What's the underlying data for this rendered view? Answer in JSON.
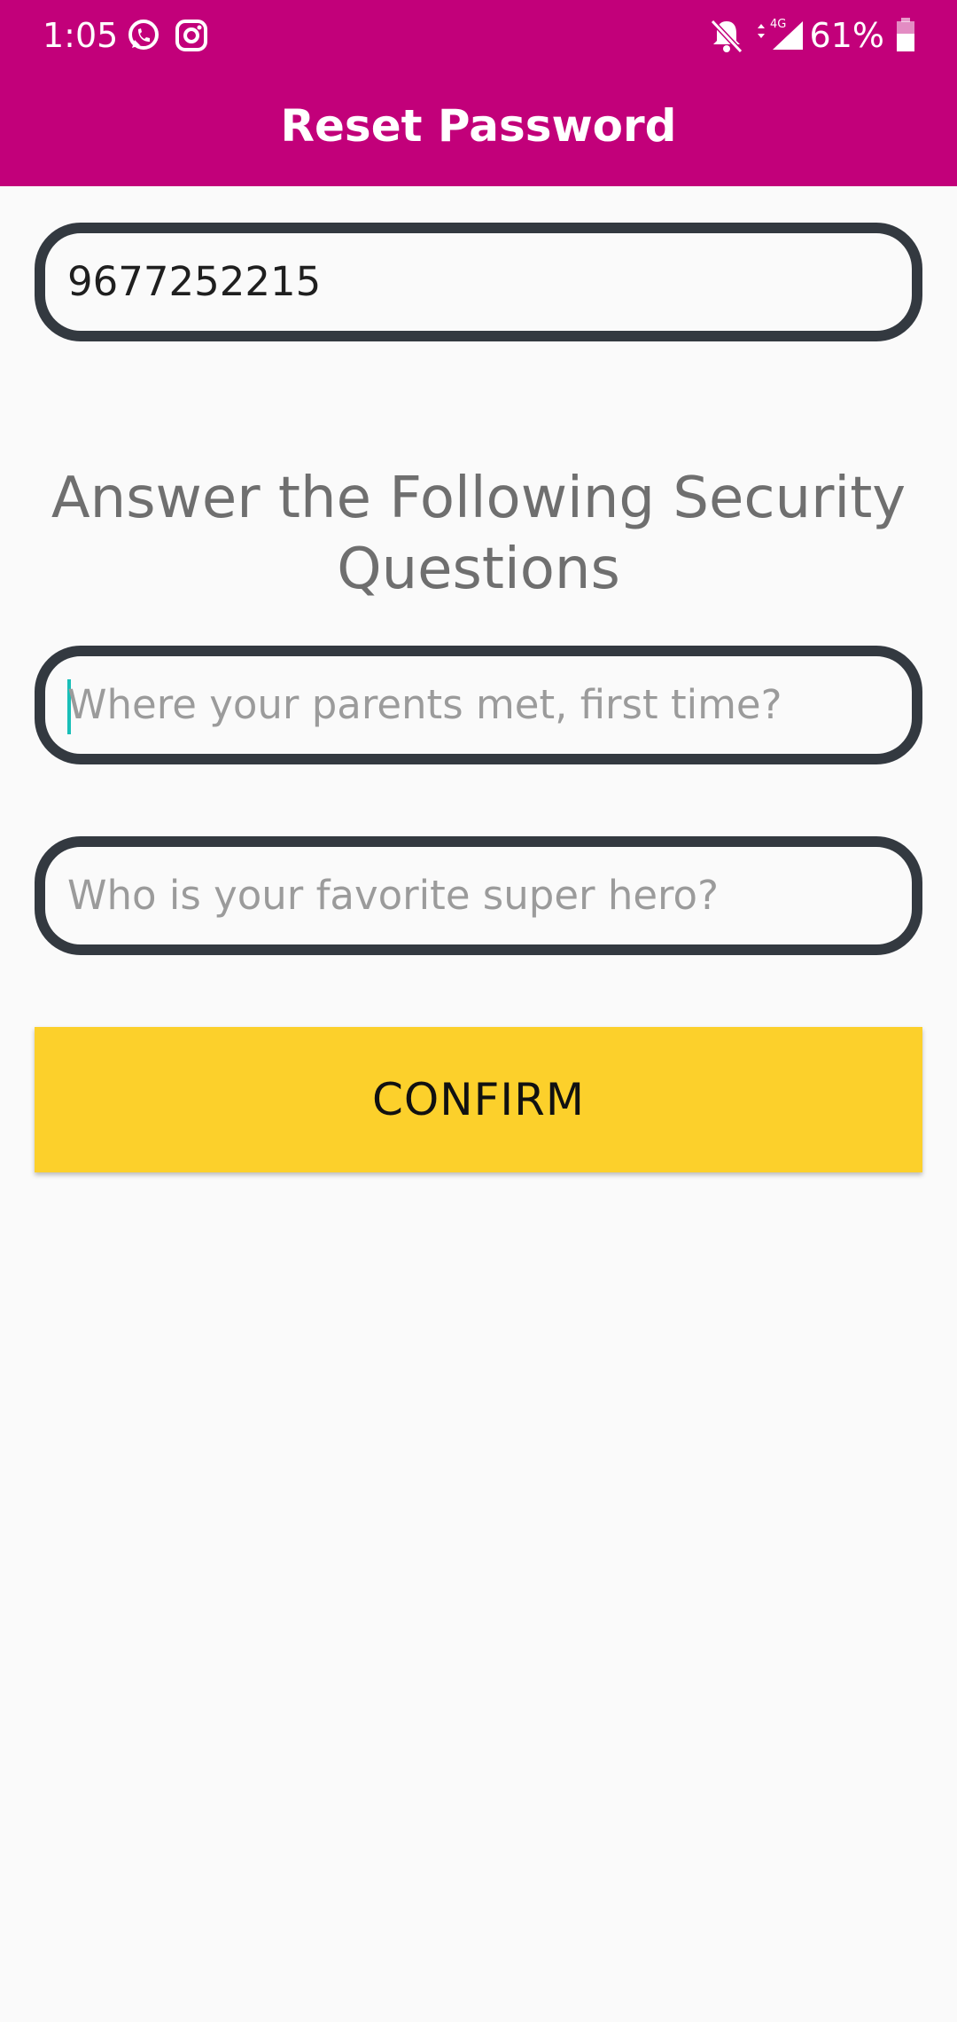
{
  "status_bar": {
    "time": "1:05",
    "battery_percent": "61%",
    "network": "4G",
    "icons": [
      "whatsapp-icon",
      "instagram-icon",
      "notifications-off-icon",
      "data-arrows-icon",
      "signal-icon",
      "battery-icon"
    ]
  },
  "app_bar": {
    "title": "Reset Password",
    "color": "#c2007a"
  },
  "form": {
    "phone_value": "9677252215",
    "heading": "Answer the Following Security Questions",
    "question1_placeholder": "Where your parents met, first time?",
    "question2_placeholder": "Who is your favorite super hero?",
    "confirm_label": "CONFIRM",
    "button_color": "#fcd02b"
  }
}
